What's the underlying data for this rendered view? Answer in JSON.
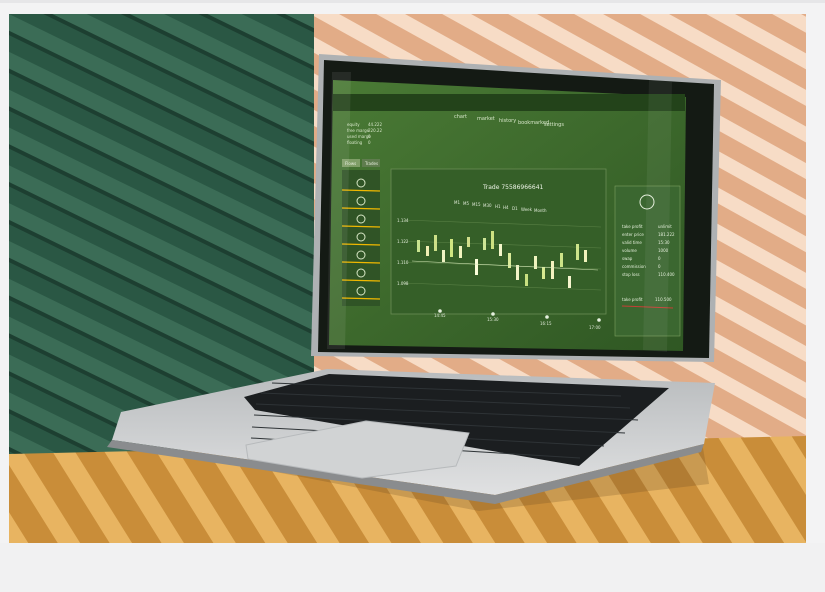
{
  "photo": {
    "screen": {
      "nav": {
        "items": [
          "chart",
          "market",
          "history",
          "bookmarked",
          "settings"
        ]
      },
      "account": {
        "labels": [
          "equity",
          "free marge",
          "used marge",
          "floating"
        ],
        "values": [
          "44.222",
          "220.22",
          "0",
          "0"
        ]
      },
      "side_tabs": [
        "Flows",
        "Trades"
      ],
      "chart": {
        "title": "Trade 75586966641",
        "timeframes": [
          "M1",
          "M5",
          "M15",
          "M30",
          "H1",
          "H4",
          "D1",
          "Week",
          "Month"
        ],
        "y_labels": [
          "1.134",
          "1.122",
          "1.110",
          "1.098"
        ],
        "x_labels": [
          "14:45",
          "15:30",
          "16:15",
          "17:00"
        ]
      },
      "right_panel": {
        "labels": [
          "take profit",
          "enter price",
          "valid time",
          "volume",
          "swap",
          "commission",
          "stop loss"
        ],
        "values": [
          "unlimit",
          "181.222",
          "15:30",
          "1000",
          "0",
          "0",
          "110.400"
        ],
        "footer_label": "take profit",
        "footer_value": "110.500"
      }
    },
    "colors": {
      "left_wall": "#2c5a46",
      "right_wall": "#e8b592",
      "table": "#d8a048",
      "screen_bg": "#3d6b2c",
      "laptop_body": "#c6c7c9"
    }
  }
}
